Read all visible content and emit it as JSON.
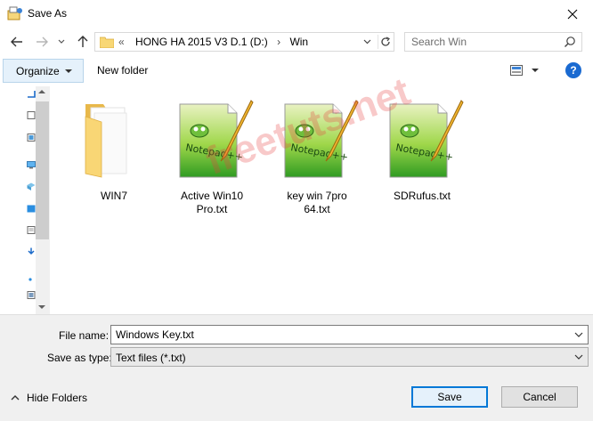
{
  "window": {
    "title": "Save As"
  },
  "address": {
    "overflow": "«",
    "crumbs": [
      "HONG HA 2015 V3 D.1 (D:)",
      "Win"
    ],
    "separator": "›"
  },
  "search": {
    "placeholder": "Search Win"
  },
  "toolbar": {
    "organize_label": "Organize",
    "new_folder_label": "New folder",
    "help_label": "?"
  },
  "files": [
    {
      "name": "WIN7",
      "kind": "folder"
    },
    {
      "name": "Active Win10 Pro.txt",
      "kind": "notepad"
    },
    {
      "name": "key win 7pro 64.txt",
      "kind": "notepad"
    },
    {
      "name": "SDRufus.txt",
      "kind": "notepad"
    }
  ],
  "watermark": "freetuts.net",
  "form": {
    "file_name_label": "File name:",
    "file_name_value": "Windows Key.txt",
    "save_type_label": "Save as type:",
    "save_type_value": "Text files (*.txt)"
  },
  "footer": {
    "hide_folders_label": "Hide Folders",
    "save_label": "Save",
    "cancel_label": "Cancel"
  },
  "colors": {
    "accent": "#0078d7",
    "help": "#1a6ad1",
    "watermark": "#e63c3c"
  }
}
